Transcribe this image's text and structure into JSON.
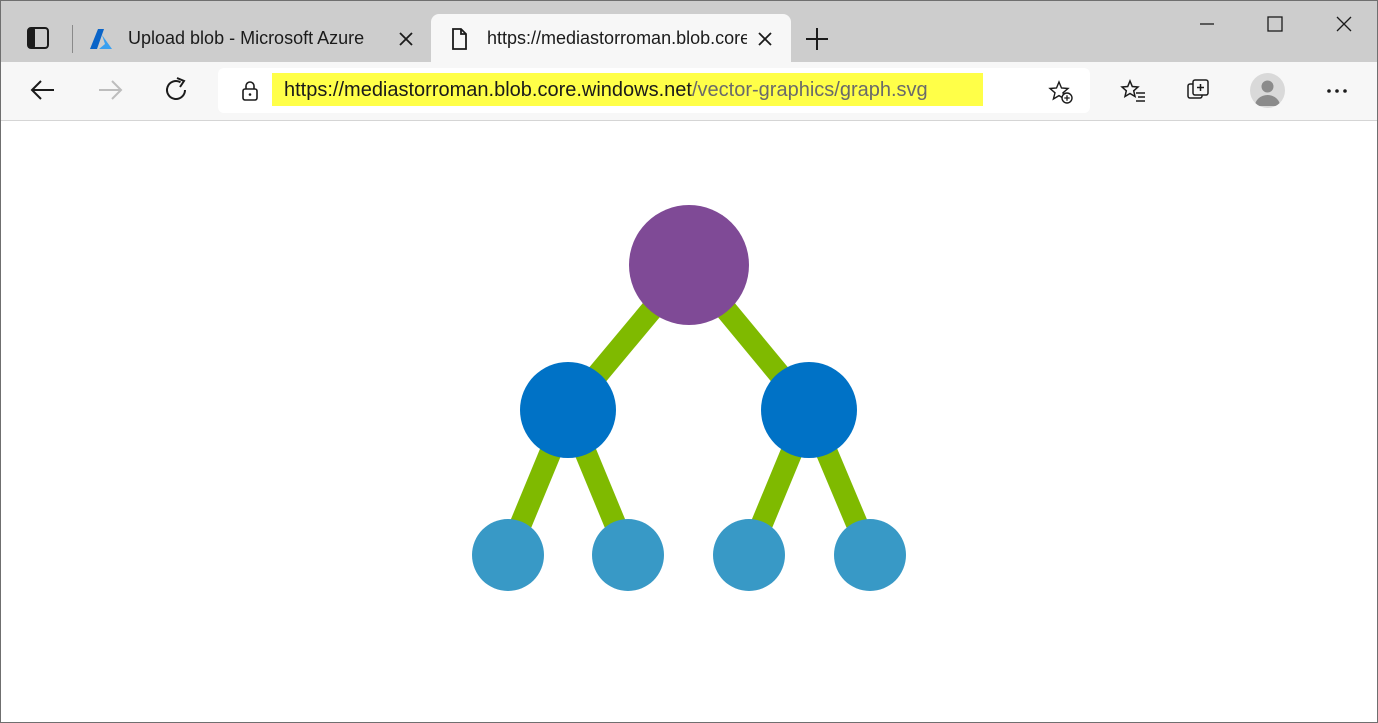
{
  "tabs": [
    {
      "title": "Upload blob - Microsoft Azure",
      "icon": "azure-logo-icon",
      "active": false
    },
    {
      "title": "https://mediastorroman.blob.core.windows.net/vector-graphics/graph.svg",
      "icon": "page-icon",
      "active": true
    }
  ],
  "address": {
    "host": "https://mediastorroman.blob.core.windows.net",
    "path": "/vector-graphics/graph.svg"
  },
  "colors": {
    "root_node": "#7f4a96",
    "mid_node": "#0072c6",
    "leaf_node": "#3899c6",
    "edge": "#7fba00",
    "url_highlight": "#ffff48"
  }
}
